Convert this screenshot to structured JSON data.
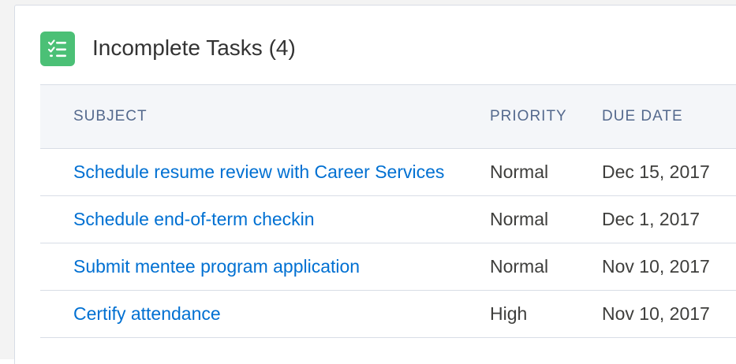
{
  "card": {
    "icon": "task-list-icon",
    "title": "Incomplete Tasks (4)",
    "accent_color": "#4bc076",
    "link_color": "#0070d2"
  },
  "table": {
    "columns": [
      "SUBJECT",
      "PRIORITY",
      "DUE DATE"
    ],
    "rows": [
      {
        "subject": "Schedule resume review with Career Services",
        "priority": "Normal",
        "due_date": "Dec 15, 2017"
      },
      {
        "subject": "Schedule end-of-term checkin",
        "priority": "Normal",
        "due_date": "Dec 1, 2017"
      },
      {
        "subject": "Submit mentee program application",
        "priority": "Normal",
        "due_date": "Nov 10, 2017"
      },
      {
        "subject": "Certify attendance",
        "priority": "High",
        "due_date": "Nov 10, 2017"
      }
    ]
  }
}
